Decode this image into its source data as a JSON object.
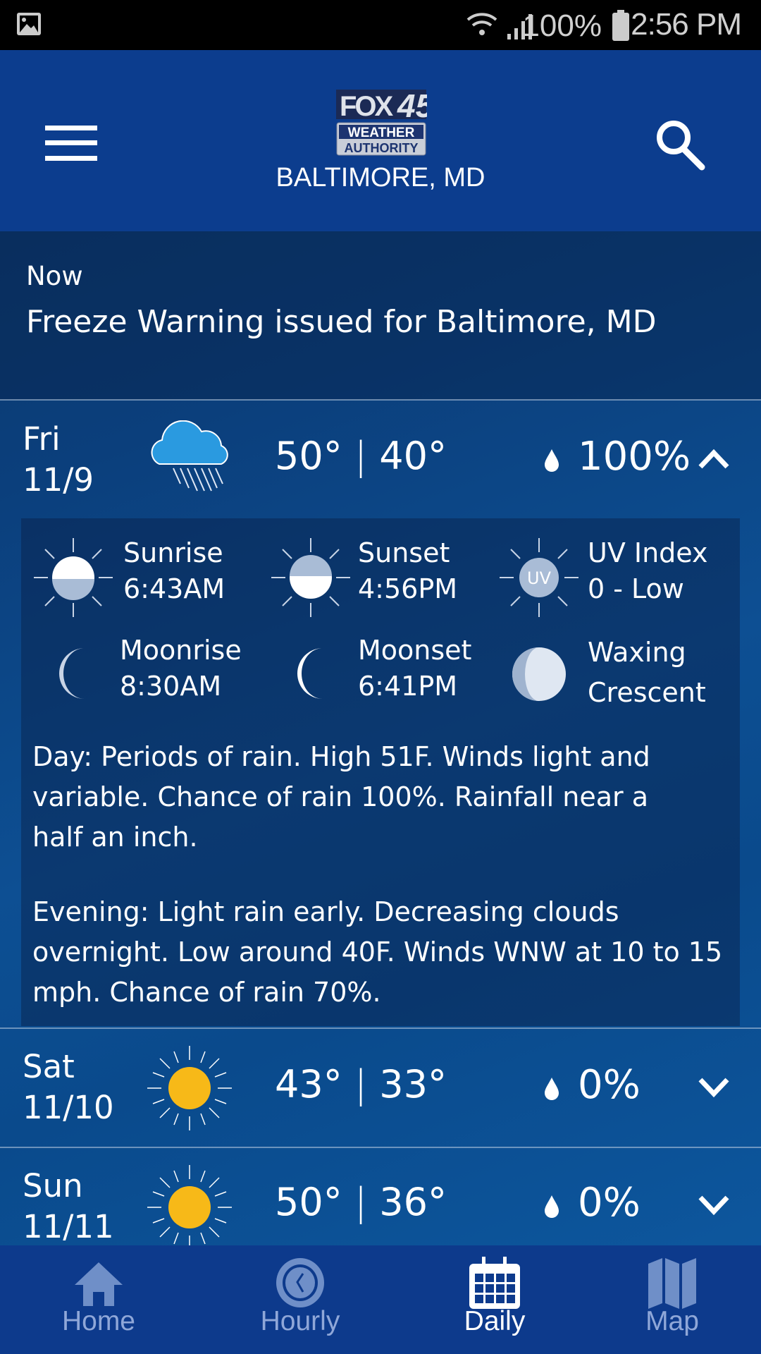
{
  "status_bar": {
    "battery": "100%",
    "time": "2:56 PM"
  },
  "header": {
    "logo_text": "FOX45 WEATHER AUTHORITY",
    "location": "BALTIMORE, MD"
  },
  "alert": {
    "label": "Now",
    "message": "Freeze Warning issued for Baltimore, MD"
  },
  "days": [
    {
      "day": "Fri",
      "date": "11/9",
      "high": "50°",
      "low": "40°",
      "separator": "|",
      "precip": "100%",
      "icon": "rain-cloud-icon",
      "expanded": true
    },
    {
      "day": "Sat",
      "date": "11/10",
      "high": "43°",
      "low": "33°",
      "separator": "|",
      "precip": "0%",
      "icon": "sun-icon",
      "expanded": false
    },
    {
      "day": "Sun",
      "date": "11/11",
      "high": "50°",
      "low": "36°",
      "separator": "|",
      "precip": "0%",
      "icon": "sun-icon",
      "expanded": false
    }
  ],
  "details": {
    "sunrise": {
      "label": "Sunrise",
      "value": "6:43AM"
    },
    "sunset": {
      "label": "Sunset",
      "value": "4:56PM"
    },
    "uv": {
      "label": "UV Index",
      "value": "0 - Low",
      "icon_text": "UV"
    },
    "moonrise": {
      "label": "Moonrise",
      "value": "8:30AM"
    },
    "moonset": {
      "label": "Moonset",
      "value": "6:41PM"
    },
    "moon_phase": {
      "line1": "Waxing",
      "line2": "Crescent"
    },
    "day_text": "Day: Periods of rain. High 51F. Winds light and variable. Chance of rain 100%. Rainfall near a half an inch.",
    "evening_text": "Evening: Light rain early. Decreasing clouds overnight. Low around 40F. Winds WNW at 10 to 15 mph. Chance of rain 70%."
  },
  "nav": [
    {
      "label": "Home"
    },
    {
      "label": "Hourly"
    },
    {
      "label": "Daily",
      "active": true
    },
    {
      "label": "Map"
    }
  ],
  "colors": {
    "header": "#0c3d8e",
    "nav": "#0d3a8c",
    "sun": "#f7b918",
    "cloud": "#2a9ae0",
    "nav_inactive": "#8fa7d8"
  }
}
